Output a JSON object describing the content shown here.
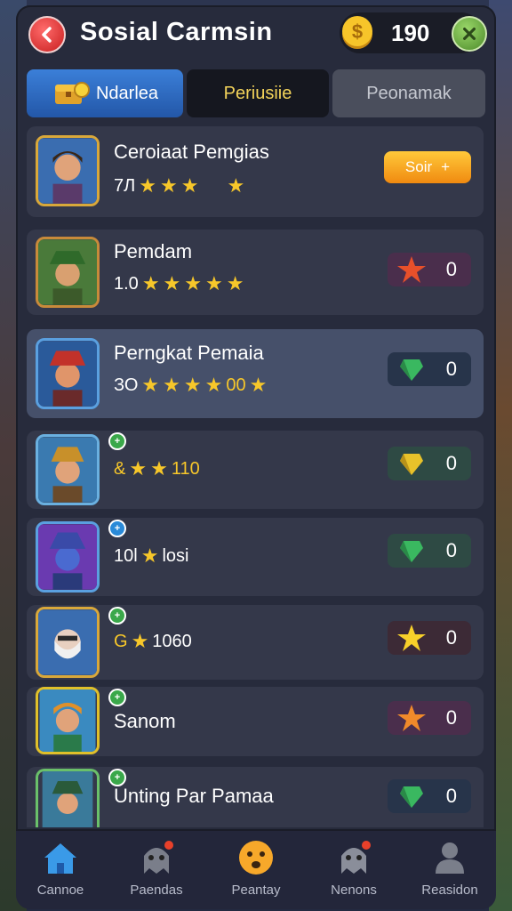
{
  "header": {
    "title": "Sosial Carmsin",
    "coins": "190"
  },
  "tabs": [
    {
      "label": "Ndarlea"
    },
    {
      "label": "Periusiie"
    },
    {
      "label": "Peonamak"
    }
  ],
  "players": [
    {
      "name": "Ceroiaat Pemgias",
      "stats_a": "7Л",
      "stats_b": "",
      "action": "Soir",
      "action_extra": "+"
    },
    {
      "name": "Pemdam",
      "stats_a": "1.0",
      "stats_b": "",
      "count": "0"
    },
    {
      "name": "Perngkat Pemaia",
      "stats_a": "ЗО",
      "stats_b": "00",
      "count": "0"
    },
    {
      "name": "",
      "stats_a": "&",
      "stats_b": "110",
      "count": "0"
    },
    {
      "name": "",
      "stats_a": "10l",
      "stats_b": "losi",
      "count": "0"
    },
    {
      "name": "",
      "stats_a": "G",
      "stats_b": "1060",
      "count": "0"
    },
    {
      "name": "Sanom",
      "stats_a": "",
      "stats_b": "",
      "count": "0"
    },
    {
      "name": "Unting Par Pamaa",
      "stats_a": "",
      "stats_b": "",
      "count": "0"
    }
  ],
  "nav": [
    {
      "label": "Cannoe",
      "icon": "home-icon"
    },
    {
      "label": "Paendas",
      "icon": "ghost-icon"
    },
    {
      "label": "Peantay",
      "icon": "emoji-icon"
    },
    {
      "label": "Nenons",
      "icon": "ghost-icon"
    },
    {
      "label": "Reasidon",
      "icon": "person-icon"
    }
  ]
}
